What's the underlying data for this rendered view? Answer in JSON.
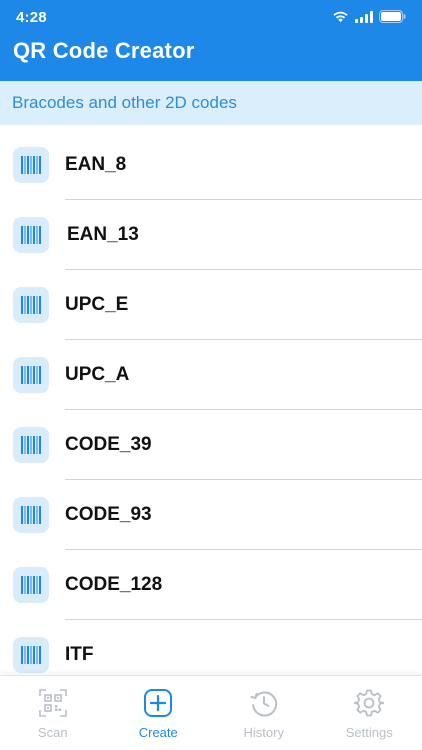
{
  "status_bar": {
    "time": "4:28"
  },
  "header": {
    "title": "QR Code Creator"
  },
  "section": {
    "title": "Bracodes and other 2D codes"
  },
  "list": {
    "items": [
      {
        "label": "EAN_8",
        "icon": "barcode-icon"
      },
      {
        "label": "EAN_13",
        "icon": "barcode-icon"
      },
      {
        "label": "UPC_E",
        "icon": "barcode-icon"
      },
      {
        "label": "UPC_A",
        "icon": "barcode-icon"
      },
      {
        "label": "CODE_39",
        "icon": "barcode-icon"
      },
      {
        "label": "CODE_93",
        "icon": "barcode-icon"
      },
      {
        "label": "CODE_128",
        "icon": "barcode-icon"
      },
      {
        "label": "ITF",
        "icon": "barcode-icon"
      }
    ]
  },
  "tabs": {
    "items": [
      {
        "label": "Scan",
        "icon": "qr-scan-icon",
        "active": false
      },
      {
        "label": "Create",
        "icon": "plus-square-icon",
        "active": true
      },
      {
        "label": "History",
        "icon": "history-clock-icon",
        "active": false
      },
      {
        "label": "Settings",
        "icon": "gear-icon",
        "active": false
      }
    ]
  },
  "colors": {
    "primary": "#1e88e8",
    "banner_background": "#dbeefb",
    "banner_text": "#2b8fd6",
    "icon_tile": "#d9ecfb",
    "inactive_tab": "#b9c0c7"
  }
}
